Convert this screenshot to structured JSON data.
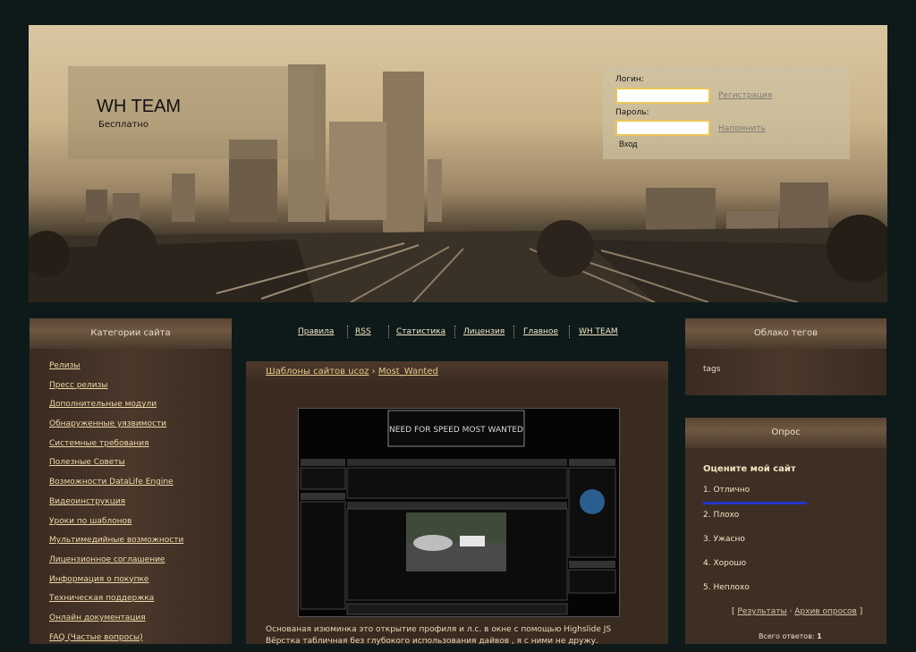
{
  "header": {
    "site_title": "WH TEAM",
    "site_subtitle": "Бесплатно",
    "login": {
      "login_label": "Логин:",
      "password_label": "Пароль:",
      "register_link": "Регистрация",
      "remind_link": "Напомнить",
      "enter_button": "Вход"
    }
  },
  "left_panel": {
    "title": "Категории сайта",
    "items": [
      "Релизы",
      "Пресс релизы",
      "Дополнительные модули",
      "Обнаруженные уязвимости",
      "Системные требования",
      "Полезные Советы",
      "Возможности DataLife Engine",
      "Видеоинструкция",
      "Уроки по шаблонов",
      "Мультимедийные возможности",
      "Лицензионное соглашение",
      "Информация о покупке",
      "Техническая поддержка",
      "Онлайн документация",
      "FAQ (Частые вопросы)"
    ]
  },
  "nav": {
    "items": [
      "Правила",
      "RSS",
      "Статистика",
      "Лицензия",
      "Главное",
      "WH TEAM"
    ]
  },
  "content": {
    "breadcrumb_parent": "Шаблоны сайтов ucoz",
    "breadcrumb_sep": "›",
    "breadcrumb_current": "Most_Wanted",
    "preview_logo": "NEED FOR SPEED MOST WANTED",
    "description_line1": "Основаная изюминка это открытие профиля и л.с. в окне с помощью Highslide JS",
    "description_line2": "Вёрстка табличная без глубокого использования дайвов , я с ними не дружу."
  },
  "tags_panel": {
    "title": "Облако тегов",
    "text": "tags"
  },
  "poll_panel": {
    "title": "Опрос",
    "question": "Оцените мой сайт",
    "options": [
      "1. Отлично",
      "2. Плохо",
      "3. Ужасно",
      "4. Хорошо",
      "5. Неплохо"
    ],
    "results_link": "Результаты",
    "archive_link": "Архив опросов",
    "bracket_open": "[",
    "bracket_close": "]",
    "dot": "·",
    "total_label": "Всего ответов:",
    "total_value": "1"
  },
  "colors": {
    "page_bg": "#0e1a1a",
    "panel_bg": "#3e2f24",
    "link_color": "#f0d9a8",
    "poll_bar": "#2236c8"
  }
}
